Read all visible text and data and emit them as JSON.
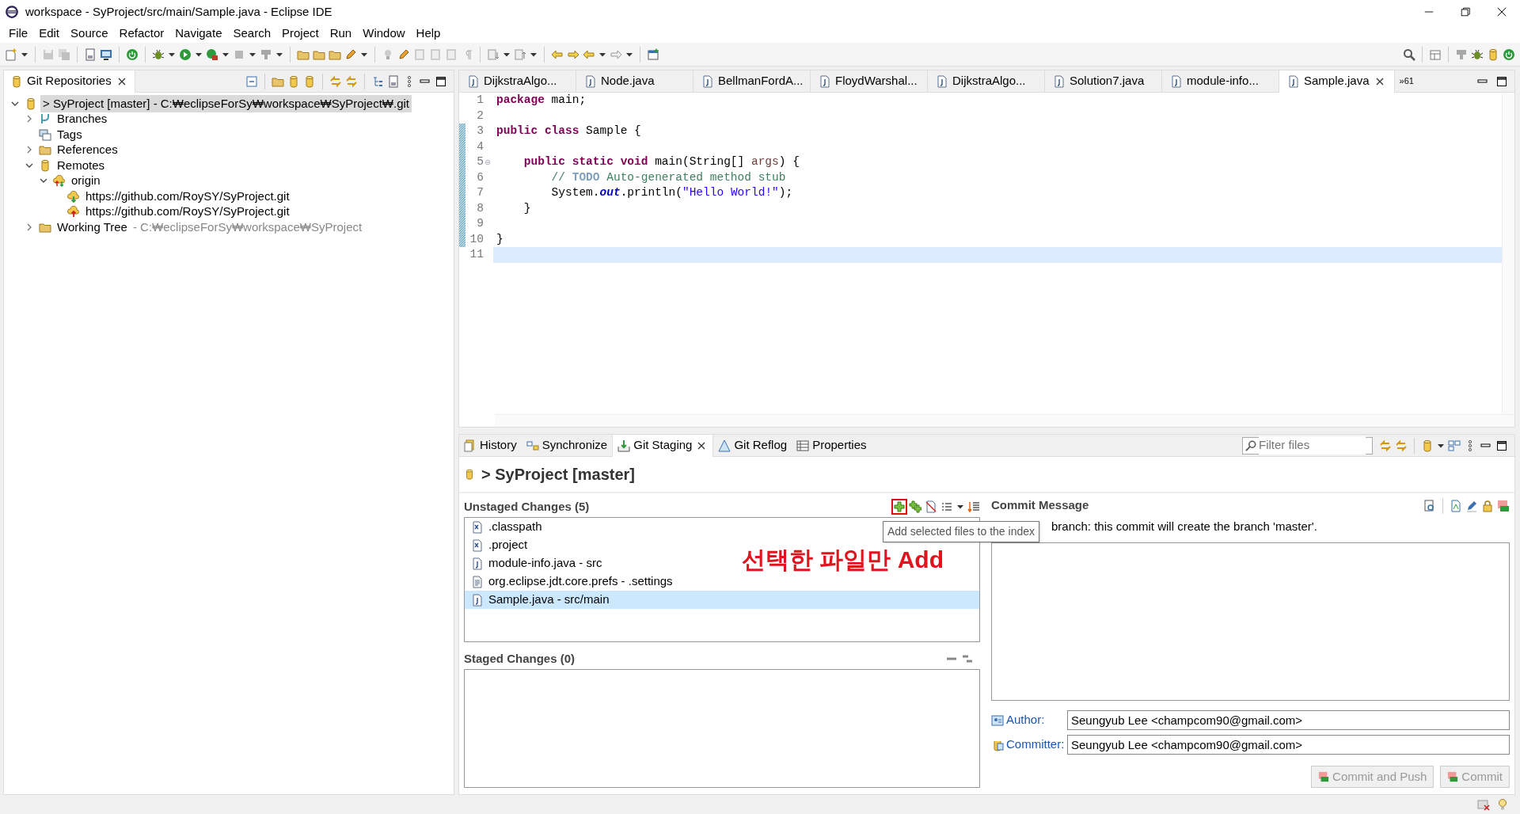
{
  "window": {
    "title": "workspace - SyProject/src/main/Sample.java - Eclipse IDE"
  },
  "menu": [
    "File",
    "Edit",
    "Source",
    "Refactor",
    "Navigate",
    "Search",
    "Project",
    "Run",
    "Window",
    "Help"
  ],
  "git_repositories": {
    "title": "Git Repositories",
    "tree": [
      {
        "kind": "repository",
        "label": "> SyProject [master] - C:₩eclipseForSy₩workspace₩SyProject₩.git",
        "expandable": true,
        "expanded": true,
        "selected": true,
        "children": [
          {
            "kind": "branches",
            "label": "Branches",
            "expandable": true,
            "expanded": false,
            "selected": false
          },
          {
            "kind": "tags",
            "label": "Tags",
            "selected": false
          },
          {
            "kind": "folder",
            "label": "References",
            "expandable": true,
            "expanded": false,
            "selected": false
          },
          {
            "kind": "remotes",
            "label": "Remotes",
            "expandable": true,
            "expanded": true,
            "selected": false,
            "children": [
              {
                "kind": "remote",
                "label": "origin",
                "expandable": true,
                "expanded": true,
                "selected": false,
                "children": [
                  {
                    "kind": "fetch-url",
                    "label": "https://github.com/RoySY/SyProject.git",
                    "selected": false
                  },
                  {
                    "kind": "push-url",
                    "label": "https://github.com/RoySY/SyProject.git",
                    "selected": false
                  }
                ]
              }
            ]
          },
          {
            "kind": "folder",
            "label": "Working Tree",
            "detail": "- C:₩eclipseForSy₩workspace₩SyProject",
            "expandable": true,
            "expanded": false,
            "selected": false
          }
        ]
      }
    ]
  },
  "editor": {
    "tabs": [
      {
        "label": "DijkstraAlgo...",
        "selected": false
      },
      {
        "label": "Node.java",
        "selected": false
      },
      {
        "label": "BellmanFordA...",
        "selected": false
      },
      {
        "label": "FloydWarshal...",
        "selected": false
      },
      {
        "label": "DijkstraAlgo...",
        "selected": false
      },
      {
        "label": "Solution7.java",
        "selected": false
      },
      {
        "label": "module-info...",
        "selected": false
      },
      {
        "label": "Sample.java",
        "selected": true
      }
    ],
    "overflow": "»61",
    "lines": [
      {
        "number": "1",
        "current": false,
        "tokens": [
          {
            "text": "package",
            "kind": "keyword"
          },
          {
            "text": " main;",
            "kind": "plain"
          }
        ]
      },
      {
        "number": "2",
        "current": false
      },
      {
        "number": "3",
        "current": false,
        "tokens": [
          {
            "text": "public class",
            "kind": "keyword"
          },
          {
            "text": " Sample {",
            "kind": "plain"
          }
        ]
      },
      {
        "number": "4",
        "current": false
      },
      {
        "number": "5",
        "current": false,
        "tokens": [
          {
            "text": "    public static void",
            "kind": "keyword"
          },
          {
            "text": " main(String[] ",
            "kind": "plain"
          },
          {
            "text": "args",
            "kind": "param"
          },
          {
            "text": ") {",
            "kind": "plain"
          }
        ]
      },
      {
        "number": "6",
        "current": false,
        "tokens": [
          {
            "text": "        // ",
            "kind": "comment"
          },
          {
            "text": "TODO",
            "kind": "todo"
          },
          {
            "text": " Auto-generated method stub",
            "kind": "comment"
          }
        ]
      },
      {
        "number": "7",
        "current": false,
        "tokens": [
          {
            "text": "        System.",
            "kind": "plain"
          },
          {
            "text": "out",
            "kind": "field"
          },
          {
            "text": ".println(",
            "kind": "plain"
          },
          {
            "text": "\"Hello World!\"",
            "kind": "string"
          },
          {
            "text": ");",
            "kind": "plain"
          }
        ]
      },
      {
        "number": "8",
        "current": false,
        "tokens": [
          {
            "text": "    }",
            "kind": "plain"
          }
        ]
      },
      {
        "number": "9",
        "current": false
      },
      {
        "number": "10",
        "current": false,
        "tokens": [
          {
            "text": "}",
            "kind": "plain"
          }
        ]
      },
      {
        "number": "11",
        "current": true
      }
    ]
  },
  "bottom_tabs": [
    {
      "label": "History",
      "selected": false
    },
    {
      "label": "Synchronize",
      "selected": false
    },
    {
      "label": "Git Staging",
      "selected": true
    },
    {
      "label": "Git Reflog",
      "selected": false
    },
    {
      "label": "Properties",
      "selected": false
    }
  ],
  "filter": {
    "placeholder": "Filter files"
  },
  "staging": {
    "repository": "> SyProject [master]",
    "unstaged": {
      "title": "Unstaged Changes (5)",
      "files": [
        {
          "kind": "xml",
          "label": ".classpath",
          "selected": false
        },
        {
          "kind": "xml",
          "label": ".project",
          "selected": false
        },
        {
          "kind": "java",
          "label": "module-info.java - src",
          "selected": false
        },
        {
          "kind": "text",
          "label": "org.eclipse.jdt.core.prefs - .settings",
          "selected": false
        },
        {
          "kind": "java",
          "label": "Sample.java - src/main",
          "selected": true
        }
      ]
    },
    "staged": {
      "title": "Staged Changes (0)"
    },
    "tooltip": "Add selected files to the index",
    "annotation": "선택한 파일만 Add",
    "commit": {
      "title": "Commit Message",
      "info": "branch: this commit will create the branch 'master'.",
      "author_label": "Author:",
      "author": "Seungyub Lee <champcom90@gmail.com>",
      "committer_label": "Committer:",
      "committer": "Seungyub Lee <champcom90@gmail.com>",
      "buttons": [
        {
          "label": "Commit and Push",
          "disabled": true
        },
        {
          "label": "Commit",
          "disabled": true
        }
      ]
    }
  }
}
